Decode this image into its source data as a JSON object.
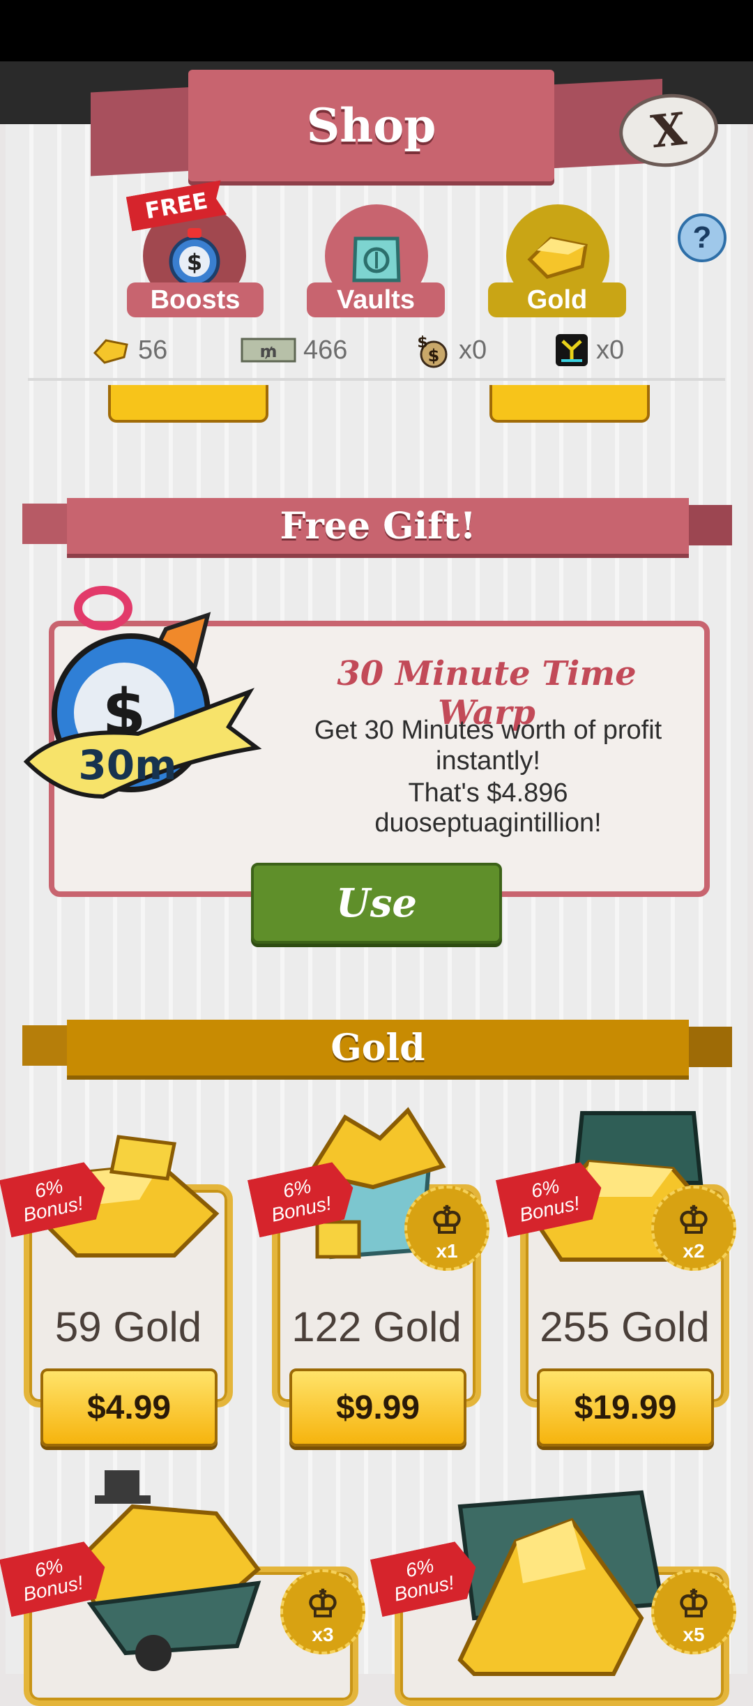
{
  "header": {
    "title": "Shop",
    "close_label": "X"
  },
  "tabs": [
    {
      "label": "Boosts",
      "tag": "FREE"
    },
    {
      "label": "Vaults"
    },
    {
      "label": "Gold"
    }
  ],
  "help_label": "?",
  "currencies": [
    {
      "icon": "gold-icon",
      "value": "56"
    },
    {
      "icon": "megabucks-icon",
      "value": "466"
    },
    {
      "icon": "money-bag-icon",
      "value": "x0"
    },
    {
      "icon": "chest-key-icon",
      "value": "x0"
    }
  ],
  "free_gift": {
    "section_title": "Free Gift!",
    "title": "30 Minute Time Warp",
    "desc_line1": "Get 30 Minutes worth of profit",
    "desc_line2": "instantly!",
    "desc_line3": "That's $4.896 duoseptuagintillion!",
    "icon_label": "30m",
    "use_label": "Use"
  },
  "gold_section": {
    "title": "Gold",
    "packs": [
      {
        "amount": "59 Gold",
        "price": "$4.99",
        "bonus_pct": "6%",
        "bonus_word": "Bonus!",
        "multiplier": ""
      },
      {
        "amount": "122 Gold",
        "price": "$9.99",
        "bonus_pct": "6%",
        "bonus_word": "Bonus!",
        "multiplier": "x1"
      },
      {
        "amount": "255 Gold",
        "price": "$19.99",
        "bonus_pct": "6%",
        "bonus_word": "Bonus!",
        "multiplier": "x2"
      },
      {
        "amount": "",
        "price": "",
        "bonus_pct": "6%",
        "bonus_word": "Bonus!",
        "multiplier": "x3"
      },
      {
        "amount": "",
        "price": "",
        "bonus_pct": "6%",
        "bonus_word": "Bonus!",
        "multiplier": "x5"
      }
    ]
  },
  "colors": {
    "shop_red": "#c8646f",
    "gold": "#c9a515",
    "use_green": "#5f8f2a",
    "bonus_red": "#d6242c"
  }
}
